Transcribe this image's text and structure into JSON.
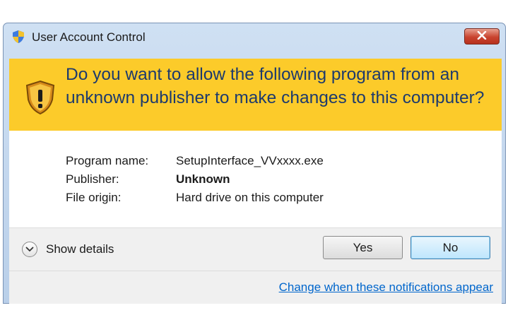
{
  "window": {
    "title": "User Account Control",
    "icon": "uac-shield-icon",
    "close_icon": "close-icon"
  },
  "banner": {
    "icon": "warning-shield-icon",
    "question": "Do you want to allow the following program from an unknown publisher to make changes to this computer?"
  },
  "program_info": [
    {
      "label": "Program name:",
      "value": "SetupInterface_VVxxxx.exe",
      "bold": false
    },
    {
      "label": "Publisher:",
      "value": "Unknown",
      "bold": true
    },
    {
      "label": "File origin:",
      "value": "Hard drive on this computer",
      "bold": false
    }
  ],
  "details": {
    "label": "Show details",
    "icon": "chevron-down-icon"
  },
  "buttons": {
    "yes": "Yes",
    "no": "No"
  },
  "footer": {
    "link": "Change when these notifications appear"
  },
  "colors": {
    "banner": "#fccb2a",
    "banner_text": "#1d3a6d",
    "link": "#0066cc",
    "close_button": "#c9432f"
  }
}
